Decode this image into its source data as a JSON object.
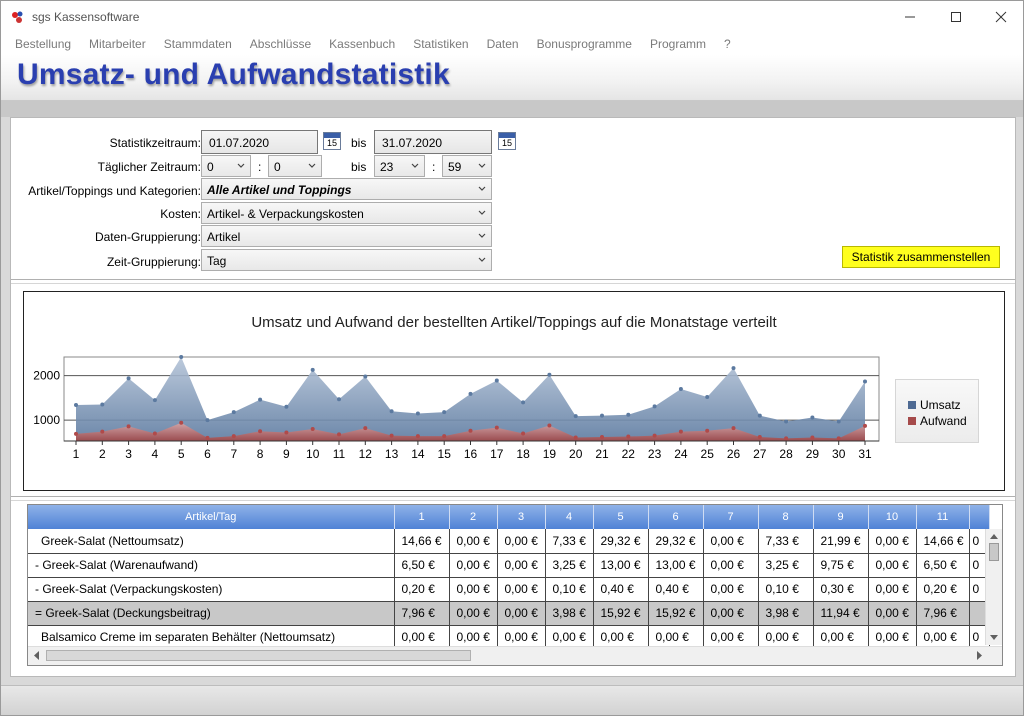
{
  "window": {
    "title": "sgs Kassensoftware"
  },
  "menu": [
    "Bestellung",
    "Mitarbeiter",
    "Stammdaten",
    "Abschlüsse",
    "Kassenbuch",
    "Statistiken",
    "Daten",
    "Bonusprogramme",
    "Programm",
    "?"
  ],
  "banner": {
    "title": "Umsatz- und Aufwandstatistik"
  },
  "form": {
    "period_label": "Statistikzeitraum:",
    "from_date": "01.07.2020",
    "bis1": "bis",
    "to_date": "31.07.2020",
    "cal_num": "15",
    "daily_label": "Täglicher Zeitraum:",
    "from_hour": "0",
    "from_min": "0",
    "colon": ":",
    "bis2": "bis",
    "to_hour": "23",
    "to_min": "59",
    "articles_label": "Artikel/Toppings und Kategorien:",
    "articles_value": "Alle Artikel und Toppings",
    "costs_label": "Kosten:",
    "costs_value": "Artikel- & Verpackungskosten",
    "grouping_label": "Daten-Gruppierung:",
    "grouping_value": "Artikel",
    "time_grouping_label": "Zeit-Gruppierung:",
    "time_grouping_value": "Tag",
    "build_button": "Statistik zusammenstellen"
  },
  "chart_data": {
    "type": "area",
    "title": "Umsatz und Aufwand der bestellten Artikel/Toppings auf die Monatstage verteilt",
    "xlabel": "",
    "ylabel": "",
    "x": [
      1,
      2,
      3,
      4,
      5,
      6,
      7,
      8,
      9,
      10,
      11,
      12,
      13,
      14,
      15,
      16,
      17,
      18,
      19,
      20,
      21,
      22,
      23,
      24,
      25,
      26,
      27,
      28,
      29,
      30,
      31
    ],
    "y_ticks": [
      1000,
      2000
    ],
    "ylim": [
      530,
      2420
    ],
    "grid": true,
    "legend_position": "right",
    "series": [
      {
        "name": "Umsatz",
        "color": "#5c7aa0",
        "values": [
          1340,
          1350,
          1940,
          1450,
          2420,
          1000,
          1180,
          1460,
          1300,
          2130,
          1470,
          1980,
          1200,
          1150,
          1180,
          1590,
          1890,
          1400,
          2020,
          1090,
          1100,
          1120,
          1310,
          1700,
          1520,
          2170,
          1100,
          970,
          1060,
          970,
          1870
        ]
      },
      {
        "name": "Aufwand",
        "color": "#b04a4a",
        "values": [
          690,
          740,
          860,
          700,
          940,
          600,
          640,
          750,
          720,
          800,
          680,
          820,
          650,
          640,
          640,
          760,
          830,
          700,
          880,
          610,
          620,
          630,
          650,
          740,
          760,
          820,
          620,
          590,
          610,
          590,
          870
        ]
      }
    ],
    "legend": [
      "Umsatz",
      "Aufwand"
    ]
  },
  "table": {
    "header_first": "Artikel/Tag",
    "day_headers": [
      "1",
      "2",
      "3",
      "4",
      "5",
      "6",
      "7",
      "8",
      "9",
      "10",
      "11"
    ],
    "rows": [
      {
        "label": "Greek-Salat (Nettoumsatz)",
        "cells": [
          "14,66 €",
          "0,00 €",
          "0,00 €",
          "7,33 €",
          "29,32 €",
          "29,32 €",
          "0,00 €",
          "7,33 €",
          "21,99 €",
          "0,00 €",
          "14,66 €"
        ],
        "partial": "0"
      },
      {
        "label": "- Greek-Salat (Warenaufwand)",
        "cells": [
          "6,50 €",
          "0,00 €",
          "0,00 €",
          "3,25 €",
          "13,00 €",
          "13,00 €",
          "0,00 €",
          "3,25 €",
          "9,75 €",
          "0,00 €",
          "6,50 €"
        ],
        "partial": "0"
      },
      {
        "label": "- Greek-Salat (Verpackungskosten)",
        "cells": [
          "0,20 €",
          "0,00 €",
          "0,00 €",
          "0,10 €",
          "0,40 €",
          "0,40 €",
          "0,00 €",
          "0,10 €",
          "0,30 €",
          "0,00 €",
          "0,20 €"
        ],
        "partial": "0"
      },
      {
        "label": "= Greek-Salat (Deckungsbeitrag)",
        "cells": [
          "7,96 €",
          "0,00 €",
          "0,00 €",
          "3,98 €",
          "15,92 €",
          "15,92 €",
          "0,00 €",
          "3,98 €",
          "11,94 €",
          "0,00 €",
          "7,96 €"
        ],
        "partial": ""
      },
      {
        "label": "Balsamico Creme im separaten Behälter (Nettoumsatz)",
        "cells": [
          "0,00 €",
          "0,00 €",
          "0,00 €",
          "0,00 €",
          "0,00 €",
          "0,00 €",
          "0,00 €",
          "0,00 €",
          "0,00 €",
          "0,00 €",
          "0,00 €"
        ],
        "partial": "0"
      }
    ]
  }
}
